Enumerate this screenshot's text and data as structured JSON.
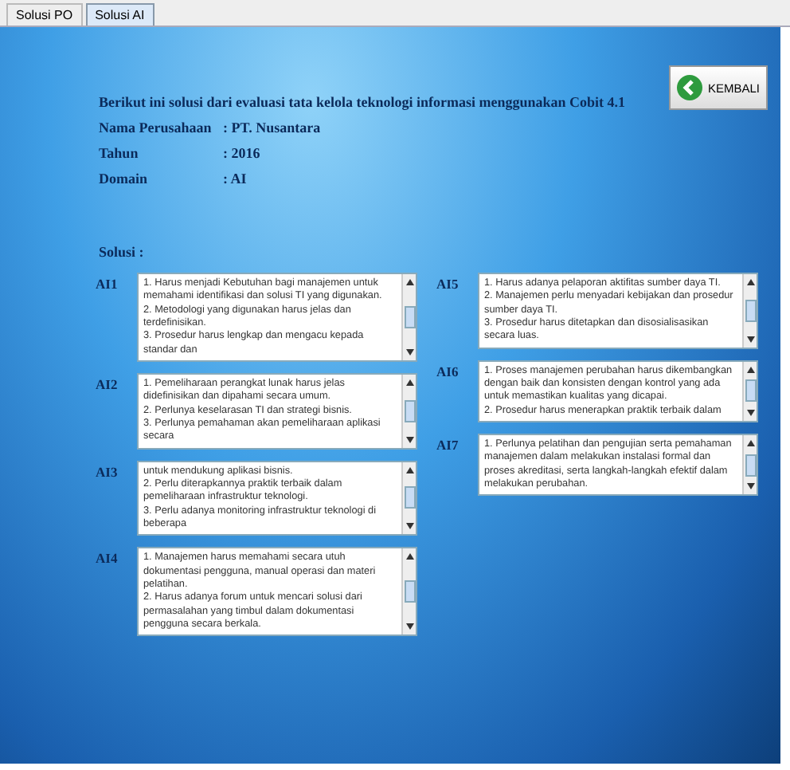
{
  "tabs": [
    {
      "label": "Solusi PO",
      "selected": false
    },
    {
      "label": "Solusi AI",
      "selected": true
    }
  ],
  "back_button": {
    "label": "KEMBALI"
  },
  "heading": "Berikut ini solusi dari evaluasi tata kelola teknologi informasi menggunakan Cobit 4.1",
  "info": [
    {
      "label": "Nama Perusahaan",
      "value": ": PT. Nusantara"
    },
    {
      "label": "Tahun",
      "value": ": 2016"
    },
    {
      "label": "Domain",
      "value": ": AI"
    }
  ],
  "solutions_label": "Solusi :",
  "solutions": {
    "left": [
      {
        "code": "AI1",
        "points": [
          "1. Harus menjadi Kebutuhan bagi manajemen untuk memahami identifikasi dan solusi TI yang digunakan.",
          "2. Metodologi yang digunakan harus jelas dan terdefinisikan.",
          "3. Prosedur harus lengkap dan mengacu kepada standar dan"
        ]
      },
      {
        "code": "AI2",
        "points": [
          "1. Pemeliharaan perangkat lunak harus jelas didefinisikan dan dipahami secara umum.",
          "2. Perlunya keselarasan TI dan strategi bisnis.",
          "3. Perlunya pemahaman akan pemeliharaan aplikasi secara"
        ]
      },
      {
        "code": "AI3",
        "points": [
          "untuk mendukung aplikasi bisnis.",
          "2. Perlu diterapkannya praktik terbaik dalam pemeliharaan infrastruktur teknologi.",
          "3. Perlu adanya monitoring infrastruktur teknologi di beberapa"
        ]
      },
      {
        "code": "AI4",
        "points": [
          "1. Manajemen harus memahami secara utuh dokumentasi pengguna, manual operasi dan materi pelatihan.",
          "2. Harus adanya forum untuk mencari solusi dari permasalahan yang timbul dalam dokumentasi pengguna secara berkala."
        ]
      }
    ],
    "right": [
      {
        "code": "AI5",
        "points": [
          "1. Harus adanya pelaporan aktifitas sumber daya TI.",
          "2. Manajemen perlu menyadari kebijakan dan prosedur sumber daya TI.",
          "3. Prosedur harus ditetapkan dan disosialisasikan secara luas."
        ]
      },
      {
        "code": "AI6",
        "points": [
          "1. Proses manajemen perubahan harus dikembangkan dengan baik dan konsisten dengan kontrol yang ada untuk memastikan kualitas yang dicapai.",
          "2. Prosedur harus menerapkan praktik terbaik dalam"
        ]
      },
      {
        "code": "AI7",
        "points": [
          "1. Perlunya pelatihan dan pengujian serta pemahaman manajemen dalam melakukan instalasi formal dan proses akreditasi, serta langkah-langkah efektif dalam melakukan perubahan."
        ]
      }
    ]
  }
}
